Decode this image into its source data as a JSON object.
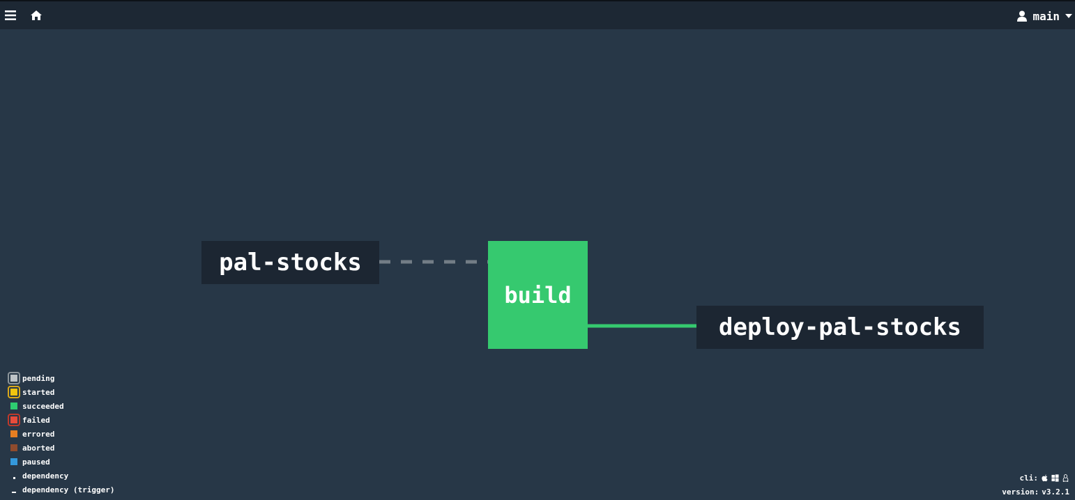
{
  "topbar": {
    "user": "main"
  },
  "graph": {
    "resources": [
      {
        "name": "pal-stocks"
      },
      {
        "name": "deploy-pal-stocks"
      }
    ],
    "jobs": [
      {
        "name": "build",
        "status": "succeeded"
      }
    ],
    "edges": [
      {
        "from": "pal-stocks",
        "to": "build",
        "style": "dependency"
      },
      {
        "from": "build",
        "to": "deploy-pal-stocks",
        "style": "output"
      }
    ]
  },
  "legend": {
    "items": [
      {
        "label": "pending",
        "color": "#bdc3c7",
        "border": "#92989c",
        "outlined": true
      },
      {
        "label": "started",
        "color": "#f1c40f",
        "border": "#e6a817",
        "outlined": true
      },
      {
        "label": "succeeded",
        "color": "#2ecc71",
        "outlined": false
      },
      {
        "label": "failed",
        "color": "#e74c3c",
        "border": "#c0392b",
        "outlined": true
      },
      {
        "label": "errored",
        "color": "#e67e22",
        "outlined": false
      },
      {
        "label": "aborted",
        "color": "#8f4b2d",
        "outlined": false
      },
      {
        "label": "paused",
        "color": "#3498db",
        "outlined": false
      },
      {
        "label": "dependency",
        "marker": "dot"
      },
      {
        "label": "dependency (trigger)",
        "marker": "dash"
      }
    ]
  },
  "footer": {
    "cli_label": "cli:",
    "cli_platforms": [
      "apple-icon",
      "windows-icon",
      "linux-icon"
    ],
    "version_label": "version:",
    "version": "v3.2.1"
  },
  "colors": {
    "background": "#273747",
    "topbar": "#1d2834",
    "resource_node": "#1c2632",
    "job_succeeded": "#36c96f",
    "dependency_edge": "#737d86",
    "output_edge": "#36c96f"
  }
}
